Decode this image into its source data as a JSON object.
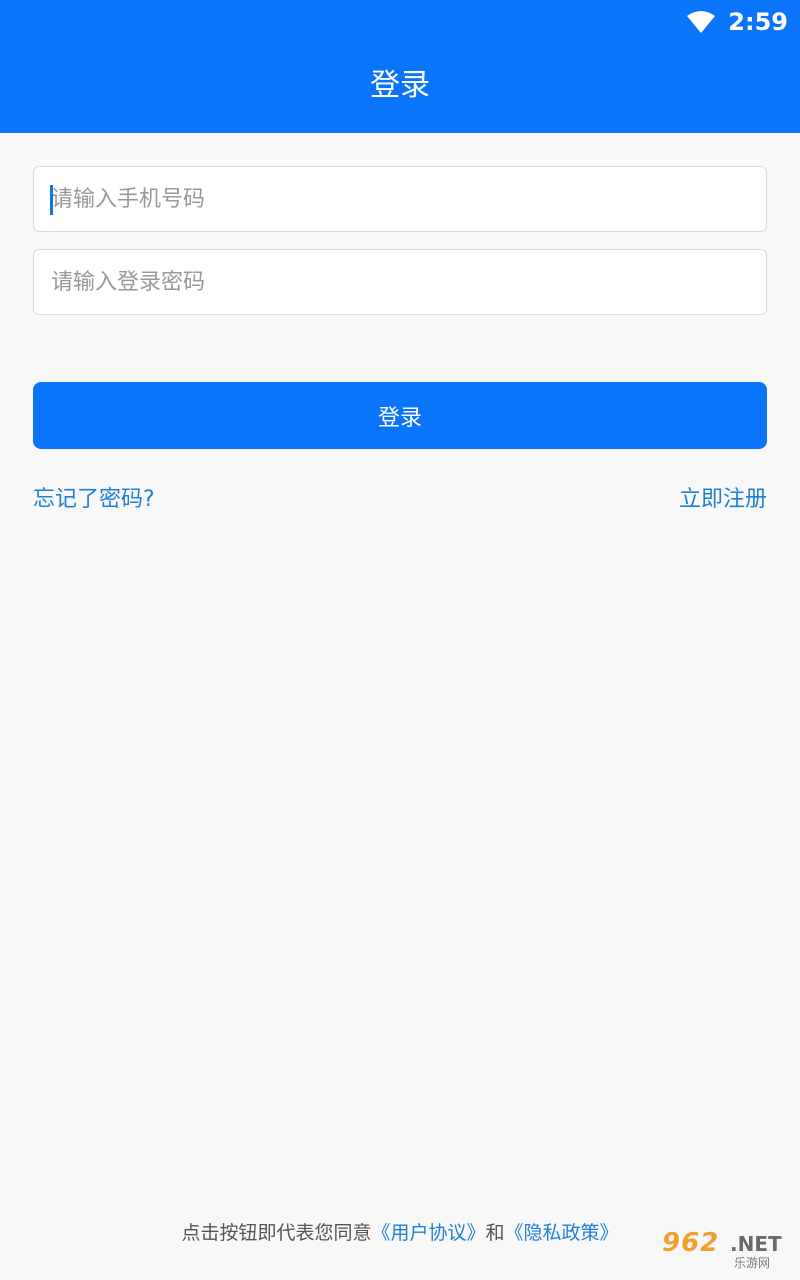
{
  "status_bar": {
    "time": "2:59",
    "wifi_icon": "wifi-icon"
  },
  "header": {
    "title": "登录"
  },
  "form": {
    "phone_placeholder": "请输入手机号码",
    "password_placeholder": "请输入登录密码",
    "login_button": "登录"
  },
  "links": {
    "forgot_password": "忘记了密码?",
    "register": "立即注册"
  },
  "footer": {
    "prefix": "点击按钮即代表您同意",
    "user_agreement": "《用户协议》",
    "and": "和",
    "privacy_policy": "《隐私政策》"
  },
  "watermark": {
    "number": "962",
    "net": ".NET",
    "site": "乐游网"
  },
  "colors": {
    "primary": "#0a74fb",
    "link": "#1f7fd6",
    "background": "#f8f8f8"
  }
}
